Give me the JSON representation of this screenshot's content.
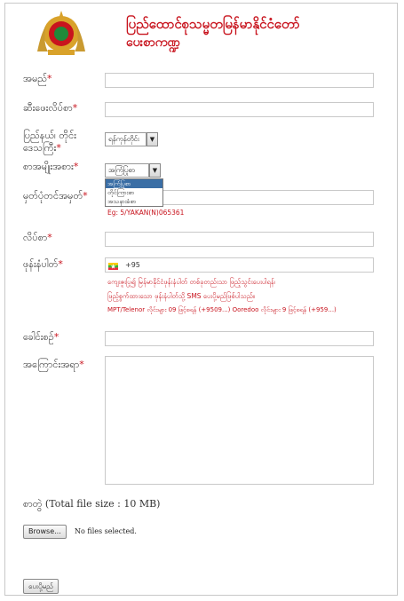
{
  "header": {
    "title_line1": "ပြည်ထောင်စုသမ္မတမြန်မာနိုင်ငံတော်",
    "title_line2": "ပေးစာကဏ္ဍ"
  },
  "form": {
    "name_label": "အမည်",
    "address_label": "ဆီးဖေးလိပ်စာ",
    "state_label_1": "ပြည်နယ်၊ တိုင်း",
    "state_label_2": "ဒေသကြီး",
    "state_value": "ရန်ကုန်တိုင်း",
    "category_label": "စာအမျိုးအစား",
    "category_value": "အကြံပြုစာ",
    "category_options": [
      "အကြံပြုစာ",
      "တိုင်ကြားစာ",
      "အသနားခံစာ"
    ],
    "nrc_label": "မှတ်ပုံတင်အမှတ်",
    "nrc_hint": "Eg: 5/YAKAN(N)065361",
    "email_label": "လိပ်စာ",
    "phone_label": "ဖုန်းနံပါတ်",
    "phone_code": "+95",
    "phone_hint_1": "ကျေးဇူးပြု၍ မြန်မာနိုင်ငံဖုန်းနံပါတ် တစ်ခုတည်းသာ ဖြည့်သွင်းပေးပါရန်၊",
    "phone_hint_2": "ဖြည့်စွက်ထားသော ဖုန်းနံပါတ်သို့ SMS ပေးပို့မည်ဖြစ်ပါသည်။",
    "phone_hint_3": "MPT/Telenor လိုင်းများ 09 ဖြင့်စရန် (+9509...) Ooredoo လိုင်းများ 9 ဖြင့်စရန် (+959...)",
    "subject_label": "ခေါင်းစဉ်",
    "content_label": "အကြောင်းအရာ",
    "attach_label": "စာတွဲ (Total file size : 10 MB)",
    "browse_label": "Browse...",
    "no_file_text": "No files selected.",
    "submit_label": "ပေးပို့မည်",
    "required_mark": "*"
  },
  "colors": {
    "accent_red": "#c8141e",
    "flag_yellow": "#fecb00",
    "flag_green": "#34b233",
    "flag_red": "#ea2839"
  }
}
